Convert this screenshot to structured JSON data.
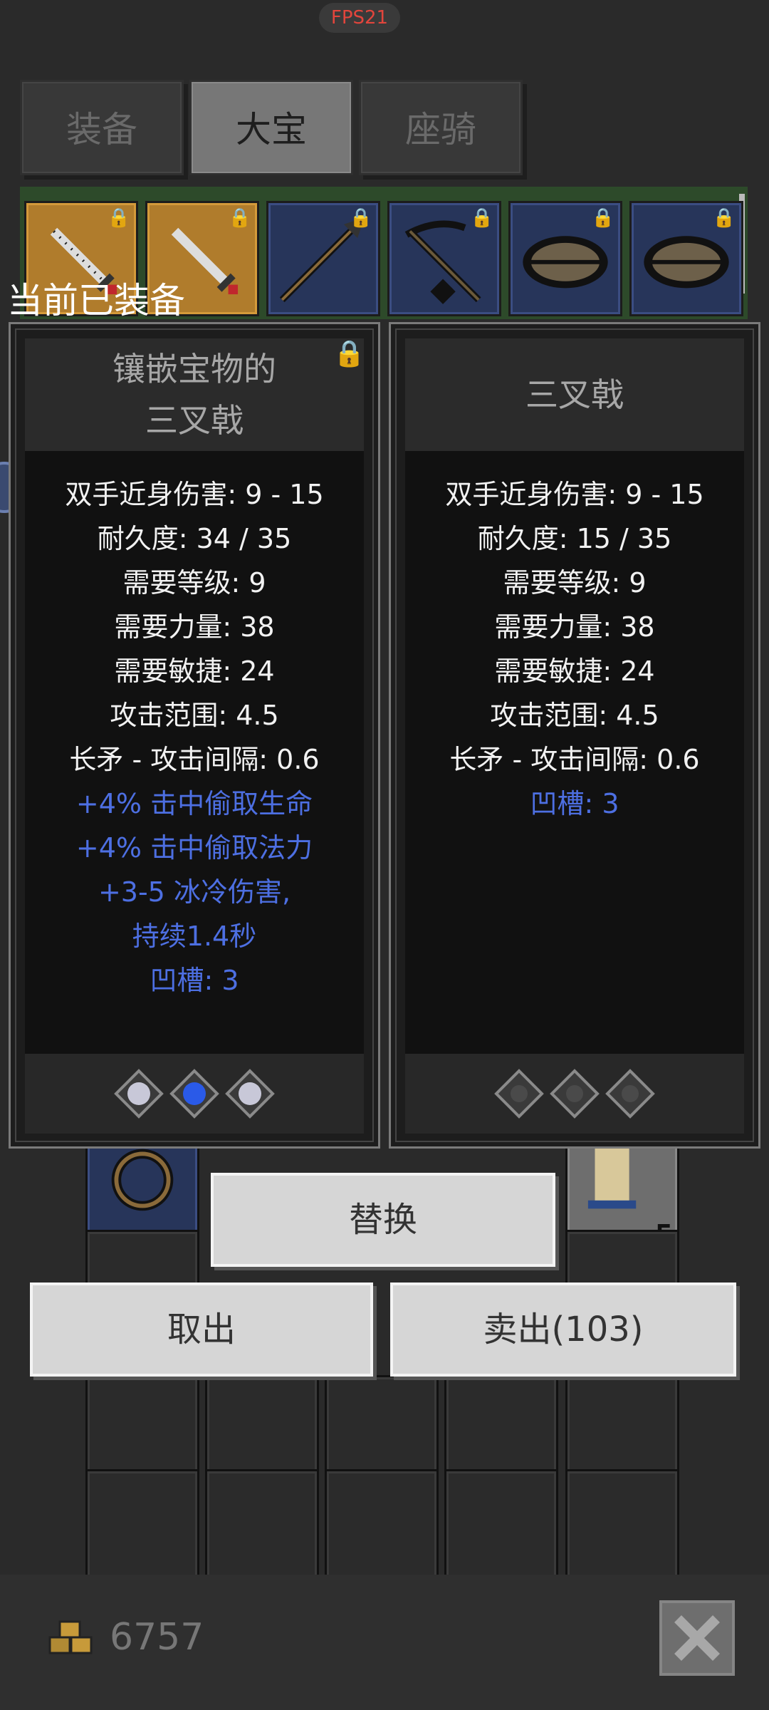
{
  "fps": "FPS21",
  "tabs": [
    "装备",
    "大宝",
    "座骑"
  ],
  "active_tab": 1,
  "equipped_label": "当前已装备",
  "left_panel": {
    "title_line1": "镶嵌宝物的",
    "title_line2": "三叉戟",
    "stats": [
      {
        "text": "双手近身伤害: 9 - 15",
        "color": "white"
      },
      {
        "text": "耐久度: 34 / 35",
        "color": "white"
      },
      {
        "text": "需要等级: 9",
        "color": "white"
      },
      {
        "text": "需要力量: 38",
        "color": "white"
      },
      {
        "text": "需要敏捷: 24",
        "color": "white"
      },
      {
        "text": "攻击范围: 4.5",
        "color": "white"
      },
      {
        "text": "长矛 - 攻击间隔: 0.6",
        "color": "white"
      },
      {
        "text": "+4% 击中偷取生命",
        "color": "blue"
      },
      {
        "text": "+4% 击中偷取法力",
        "color": "blue"
      },
      {
        "text": "+3-5 冰冷伤害,",
        "color": "blue"
      },
      {
        "text": "持续1.4秒",
        "color": "blue"
      },
      {
        "text": "凹槽: 3",
        "color": "blue"
      }
    ],
    "gems": [
      "skull-gem",
      "sapphire-gem",
      "skull-gem"
    ]
  },
  "right_panel": {
    "title": "三叉戟",
    "stats": [
      {
        "text": "双手近身伤害: 9 - 15",
        "color": "white"
      },
      {
        "text": "耐久度: 15 / 35",
        "color": "white"
      },
      {
        "text": "需要等级: 9",
        "color": "white"
      },
      {
        "text": "需要力量: 38",
        "color": "white"
      },
      {
        "text": "需要敏捷: 24",
        "color": "white"
      },
      {
        "text": "攻击范围: 4.5",
        "color": "white"
      },
      {
        "text": "长矛 - 攻击间隔: 0.6",
        "color": "white"
      },
      {
        "text": "凹槽: 3",
        "color": "blue"
      }
    ],
    "gems": [
      "empty-socket",
      "empty-socket",
      "empty-socket"
    ]
  },
  "buttons": {
    "replace": "替换",
    "take_out": "取出",
    "sell": "卖出(103)"
  },
  "inventory": {
    "stack_count": "5"
  },
  "gold": "6757",
  "colors": {
    "stat_white": "#f2f2f2",
    "stat_blue": "#4d6fe2",
    "fps_red": "#e2453c"
  }
}
